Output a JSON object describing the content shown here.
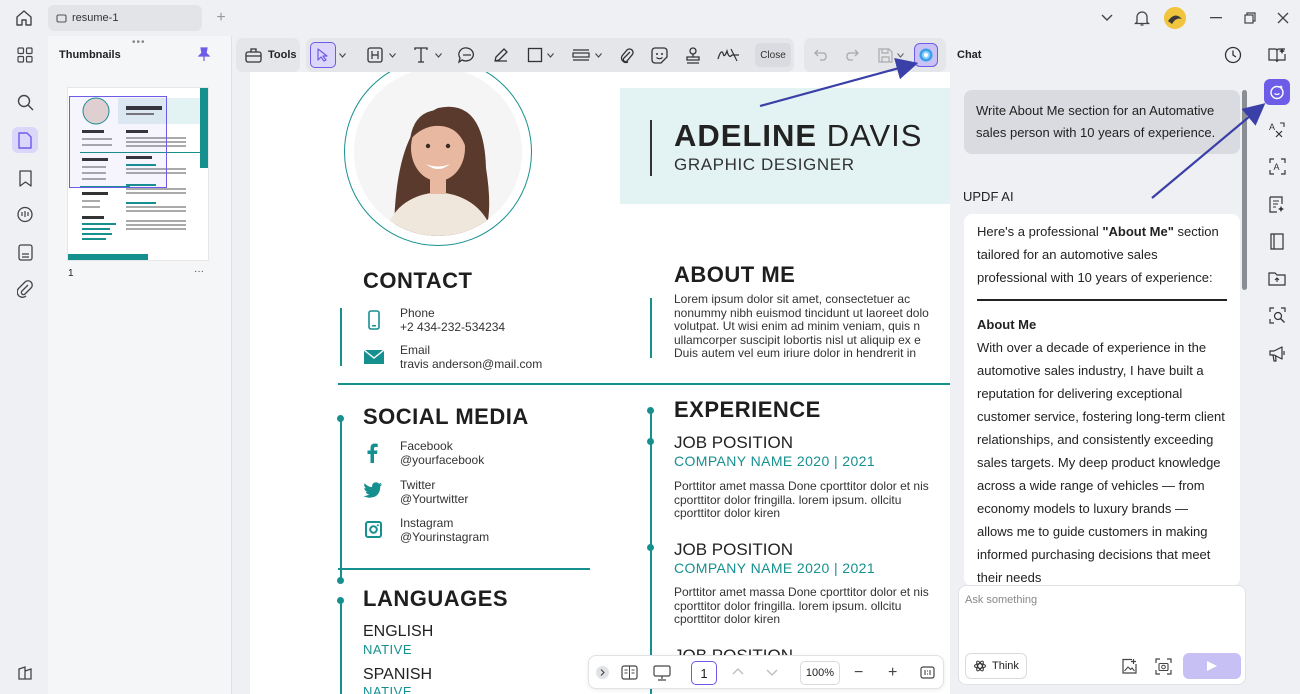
{
  "titlebar": {
    "tab_title": "resume-1"
  },
  "thumbnails": {
    "title": "Thumbnails",
    "page_number": "1",
    "more": "···"
  },
  "toolbar": {
    "tools_label": "Tools",
    "close_label": "Close"
  },
  "resume": {
    "first_name": "ADELINE",
    "last_name": "DAVIS",
    "job_title": "GRAPHIC DESIGNER",
    "contact_title": "CONTACT",
    "phone_label": "Phone",
    "phone_value": "+2 434-232-534234",
    "email_label": "Email",
    "email_value": "travis anderson@mail.com",
    "social_title": "SOCIAL MEDIA",
    "facebook_label": "Facebook",
    "facebook_value": "@yourfacebook",
    "twitter_label": "Twitter",
    "twitter_value": "@Yourtwitter",
    "instagram_label": "Instagram",
    "instagram_value": "@Yourinstagram",
    "languages_title": "LANGUAGES",
    "lang1": "ENGLISH",
    "lang1_level": "NATIVE",
    "lang2": "SPANISH",
    "lang2_level": "NATIVE",
    "about_title": "ABOUT ME",
    "about_lines": [
      "Lorem ipsum dolor sit amet, consectetuer ac",
      "nonummy nibh euismod tincidunt ut laoreet dolo",
      "volutpat. Ut wisi enim ad minim veniam, quis n",
      "ullamcorper suscipit lobortis nisl ut aliquip ex e",
      "Duis autem vel eum iriure dolor in hendrerit in"
    ],
    "experience_title": "EXPERIENCE",
    "job1_title": "JOB POSITION",
    "job1_company": "COMPANY NAME 2020 | 2021",
    "job1_lines": [
      "Porttitor amet massa Done cporttitor dolor et nis",
      "cporttitor dolor fringilla. lorem ipsum. ollcitu",
      "cporttitor dolor kiren"
    ],
    "job2_title": "JOB POSITION",
    "job2_company": "COMPANY NAME 2020 | 2021",
    "job2_lines": [
      "Porttitor amet massa Done cporttitor dolor et nis",
      "cporttitor dolor fringilla. lorem ipsum. ollcitu",
      "cporttitor dolor kiren"
    ],
    "job3_title": "JOB POSITION"
  },
  "chat": {
    "title": "Chat",
    "user_message": "Write About Me section for an Automative sales person with 10 years of experience.",
    "ai_name": "UPDF AI",
    "ai_intro_pre": "Here's a professional ",
    "ai_intro_bold": "\"About Me\"",
    "ai_intro_post": " section tailored for an automotive sales professional with 10 years of experience:",
    "ai_heading": "About Me",
    "ai_body": "With over a decade of experience in the automotive sales industry, I have built a reputation for delivering exceptional customer service, fostering long-term client relationships, and consistently exceeding sales targets. My deep product knowledge across a wide range of vehicles — from economy models to luxury brands — allows me to guide customers in making informed purchasing decisions that meet their needs",
    "input_placeholder": "Ask something",
    "think_label": "Think"
  },
  "pagenav": {
    "page": "1",
    "zoom": "100%"
  },
  "colors": {
    "accent": "#16908f",
    "brand": "#6c5ce7",
    "arrow": "#3b3fa8"
  }
}
